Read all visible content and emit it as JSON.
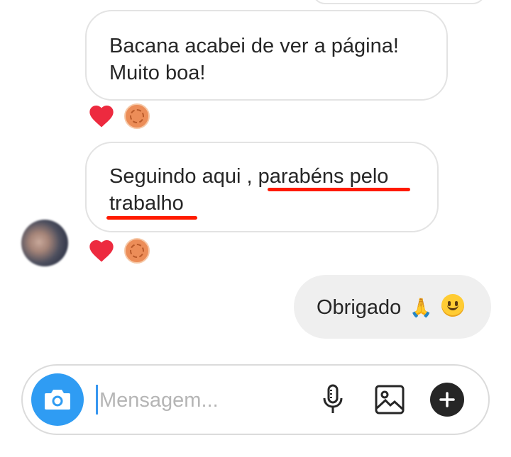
{
  "messages": [
    {
      "sender": "other",
      "text_line1": "Bacana acabei de ver a página!",
      "text_line2": "Muito boa!"
    },
    {
      "sender": "other",
      "text_line1": "Seguindo aqui , parabéns pelo",
      "text_line2": "trabalho"
    },
    {
      "sender": "me",
      "text": "Obrigado",
      "emoji": "🙏"
    }
  ],
  "composer": {
    "placeholder": "Mensagem..."
  },
  "icons": {
    "camera": "camera-icon",
    "mic": "microphone-icon",
    "gallery": "image-icon",
    "plus": "plus-icon",
    "heart": "heart-icon",
    "sticker": "sticker-icon"
  },
  "colors": {
    "accent": "#2f9cf3",
    "heart": "#ed2a3f",
    "underline": "#ff1a00",
    "bubble_mine": "#efefef"
  }
}
